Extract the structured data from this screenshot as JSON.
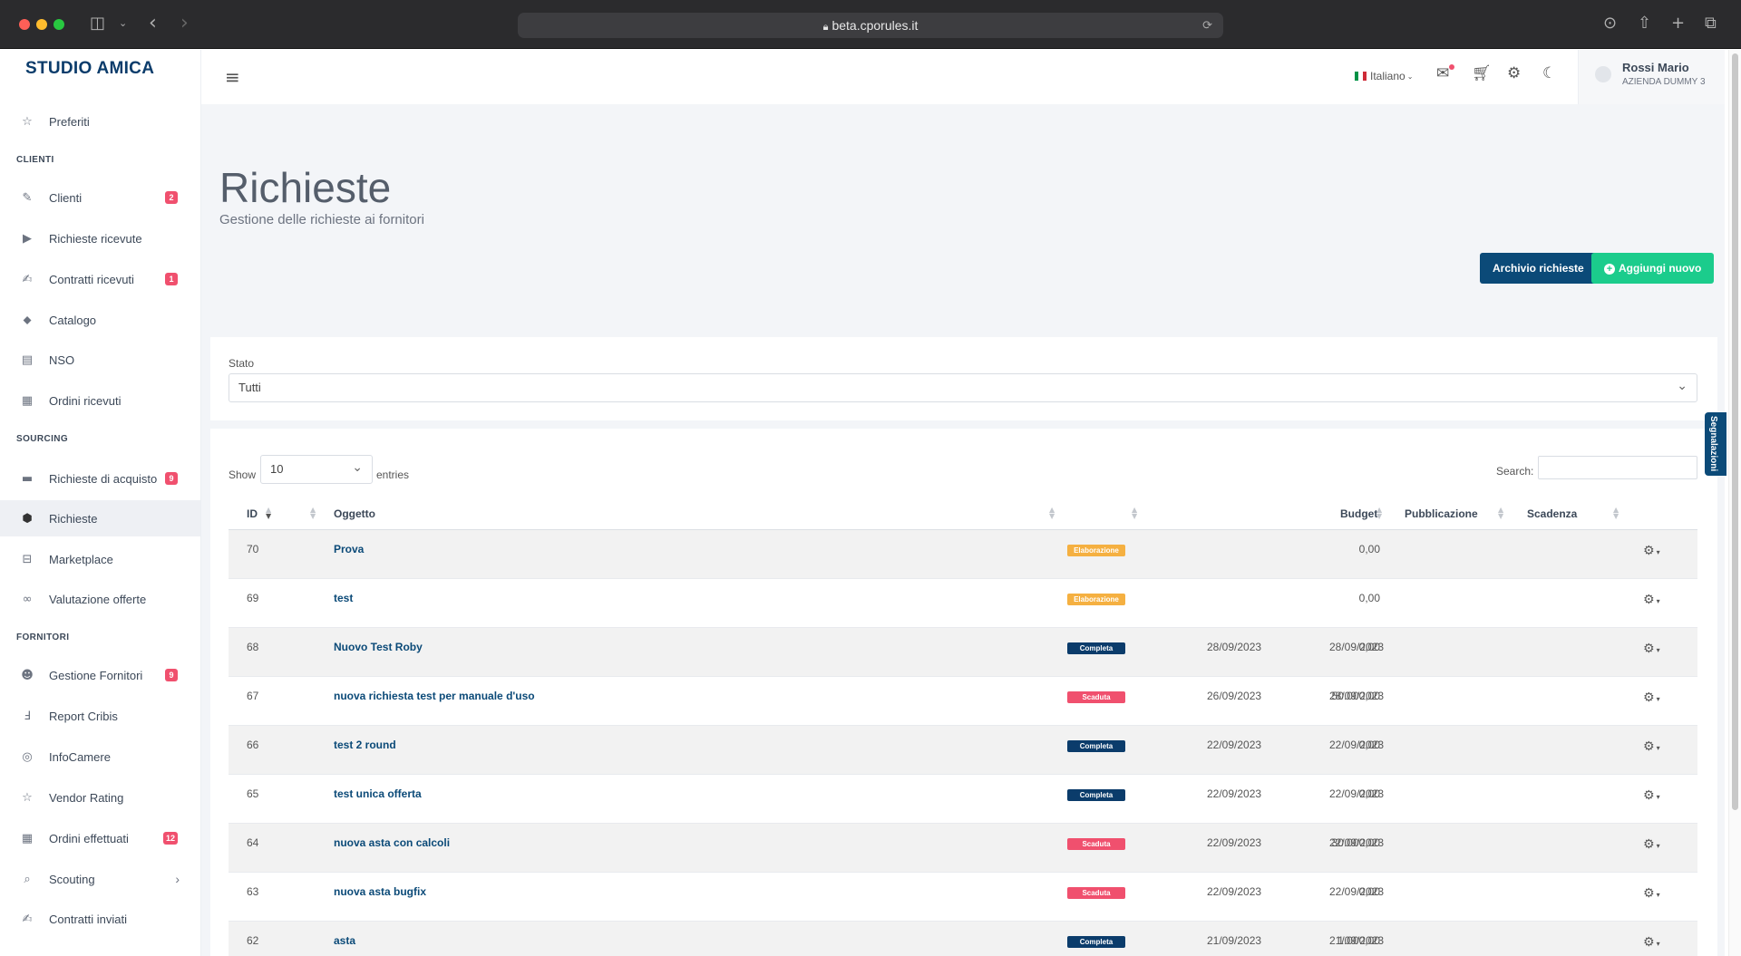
{
  "browser": {
    "url": "beta.cporules.it"
  },
  "sidebar": {
    "brand": "STUDIO AMICA",
    "items": [
      {
        "label": "Preferiti",
        "icon": "star-icon",
        "glyph": "☆"
      },
      {
        "section": "CLIENTI"
      },
      {
        "label": "Clienti",
        "icon": "handshake-icon",
        "glyph": "✎",
        "badge": "2"
      },
      {
        "label": "Richieste ricevute",
        "icon": "play-circle-icon",
        "glyph": "▶"
      },
      {
        "label": "Contratti ricevuti",
        "icon": "file-signature-icon",
        "glyph": "✍",
        "badge": "1"
      },
      {
        "label": "Catalogo",
        "icon": "tags-icon",
        "glyph": "⬥"
      },
      {
        "label": "NSO",
        "icon": "list-alt-icon",
        "glyph": "▤"
      },
      {
        "label": "Ordini ricevuti",
        "icon": "receipt-icon",
        "glyph": "▦"
      },
      {
        "section": "SOURCING"
      },
      {
        "label": "Richieste di acquisto",
        "icon": "credit-card-icon",
        "glyph": "▬",
        "badge": "9"
      },
      {
        "label": "Richieste",
        "icon": "cube-icon",
        "glyph": "⬢",
        "active": true
      },
      {
        "label": "Marketplace",
        "icon": "shopping-bag-icon",
        "glyph": "⊟"
      },
      {
        "label": "Valutazione offerte",
        "icon": "glasses-icon",
        "glyph": "∞"
      },
      {
        "section": "FORNITORI"
      },
      {
        "label": "Gestione Fornitori",
        "icon": "users-icon",
        "glyph": "☻",
        "badge": "9"
      },
      {
        "label": "Report Cribis",
        "icon": "cribis-logo-icon",
        "glyph": "Ⅎ"
      },
      {
        "label": "InfoCamere",
        "icon": "infocamere-logo-icon",
        "glyph": "◎"
      },
      {
        "label": "Vendor Rating",
        "icon": "star-outline-icon",
        "glyph": "☆"
      },
      {
        "label": "Ordini effettuati",
        "icon": "receipt-outline-icon",
        "glyph": "▦",
        "badge": "12"
      },
      {
        "label": "Scouting",
        "icon": "search-icon",
        "glyph": "⌕",
        "chevron": "›"
      },
      {
        "label": "Contratti inviati",
        "icon": "file-signature-icon",
        "glyph": "✍"
      }
    ]
  },
  "topbar": {
    "language": "Italiano",
    "user_name": "Rossi Mario",
    "user_company": "AZIENDA DUMMY 3"
  },
  "page": {
    "title": "Richieste",
    "subtitle": "Gestione delle richieste ai fornitori",
    "archive_button": "Archivio richieste",
    "add_button": "Aggiungi nuovo"
  },
  "filter": {
    "label": "Stato",
    "value": "Tutti"
  },
  "table": {
    "show_label": "Show",
    "show_value": "10",
    "entries_label": "entries",
    "search_label": "Search:",
    "headers": {
      "id": "ID",
      "object": "Oggetto",
      "budget": "Budget",
      "published": "Pubblicazione",
      "expiry": "Scadenza"
    },
    "rows": [
      {
        "id": "70",
        "object": "Prova",
        "status": "Elaborazione",
        "budget": "0,00",
        "published": "",
        "expiry": ""
      },
      {
        "id": "69",
        "object": "test",
        "status": "Elaborazione",
        "budget": "0,00",
        "published": "",
        "expiry": ""
      },
      {
        "id": "68",
        "object": "Nuovo Test Roby",
        "status": "Completa",
        "budget": "0,00",
        "published": "28/09/2023",
        "expiry": "28/09/2023"
      },
      {
        "id": "67",
        "object": "nuova richiesta test per manuale d'uso",
        "status": "Scaduta",
        "budget": "50.000,00",
        "published": "26/09/2023",
        "expiry": "28/09/2023"
      },
      {
        "id": "66",
        "object": "test 2 round",
        "status": "Completa",
        "budget": "0,00",
        "published": "22/09/2023",
        "expiry": "22/09/2023"
      },
      {
        "id": "65",
        "object": "test unica offerta",
        "status": "Completa",
        "budget": "0,00",
        "published": "22/09/2023",
        "expiry": "22/09/2023"
      },
      {
        "id": "64",
        "object": "nuova asta con calcoli",
        "status": "Scaduta",
        "budget": "30.000,00",
        "published": "22/09/2023",
        "expiry": "22/09/2023"
      },
      {
        "id": "63",
        "object": "nuova asta bugfix",
        "status": "Scaduta",
        "budget": "0,00",
        "published": "22/09/2023",
        "expiry": "22/09/2023"
      },
      {
        "id": "62",
        "object": "asta",
        "status": "Completa",
        "budget": "1.000,00",
        "published": "21/09/2023",
        "expiry": "21/09/2023"
      }
    ]
  },
  "status_colors": {
    "Elaborazione": "#f5b041",
    "Completa": "#0b3c6b",
    "Scaduta": "#f0506e"
  },
  "side_tab": "Segnalazioni"
}
